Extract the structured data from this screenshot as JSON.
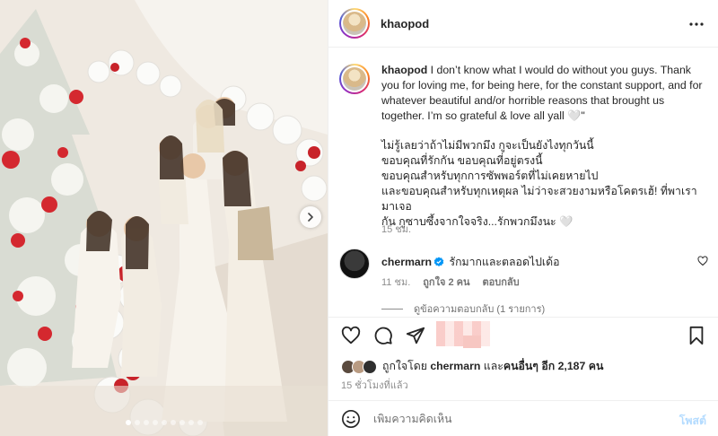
{
  "post": {
    "author": "khaopod",
    "caption_en": "I don’t know what I would do without you guys. Thank you for loving me, for being here, for the constant support, and for whatever beautiful and/or horrible reasons that brought us together. I’m so grateful & love all yall 🤍\"",
    "caption_th_lines": [
      "ไม่รู้เลยว่าถ้าไม่มีพวกมึง กูจะเป็นยังไงทุกวันนี้",
      "ขอบคุณที่รักกัน ขอบคุณที่อยู่ตรงนี้",
      "ขอบคุณสำหรับทุกการซัพพอร์ตที่ไม่เคยหายไป",
      "และขอบคุณสำหรับทุกเหตุผล ไม่ว่าจะสวยงามหรือโคตรเฮ้! ที่พาเรามาเจอ",
      "กัน กูซาบซึ้งจากใจจริง...รักพวกมึงนะ 🤍"
    ],
    "caption_time": "15 ชม."
  },
  "comment": {
    "author": "chermarn",
    "text": "รักมากและตลอดไปเด้อ",
    "time": "11 ชม.",
    "likes": "ถูกใจ 2 คน",
    "reply": "ตอบกลับ",
    "view_replies": "ดูข้อความตอบกลับ (1 รายการ)"
  },
  "likes_line": {
    "prefix": "ถูกใจโดย",
    "user": "chermarn",
    "middle": "และ",
    "others": "คนอื่นๆ อีก 2,187 คน"
  },
  "posted_ago": "15 ชั่วโมงที่แล้ว",
  "comment_box": {
    "placeholder": "เพิ่มความคิดเห็น",
    "post_label": "โพสต์"
  },
  "carousel": {
    "count": 9,
    "active_index": 0
  },
  "colors": {
    "link": "#0095f6",
    "post_disabled": "#b3dbff",
    "verified": "#0095f6"
  },
  "icons": [
    "more-options-icon",
    "heart-icon",
    "comment-icon",
    "share-icon",
    "bookmark-icon",
    "emoji-icon",
    "verified-icon",
    "chevron-right-icon"
  ]
}
